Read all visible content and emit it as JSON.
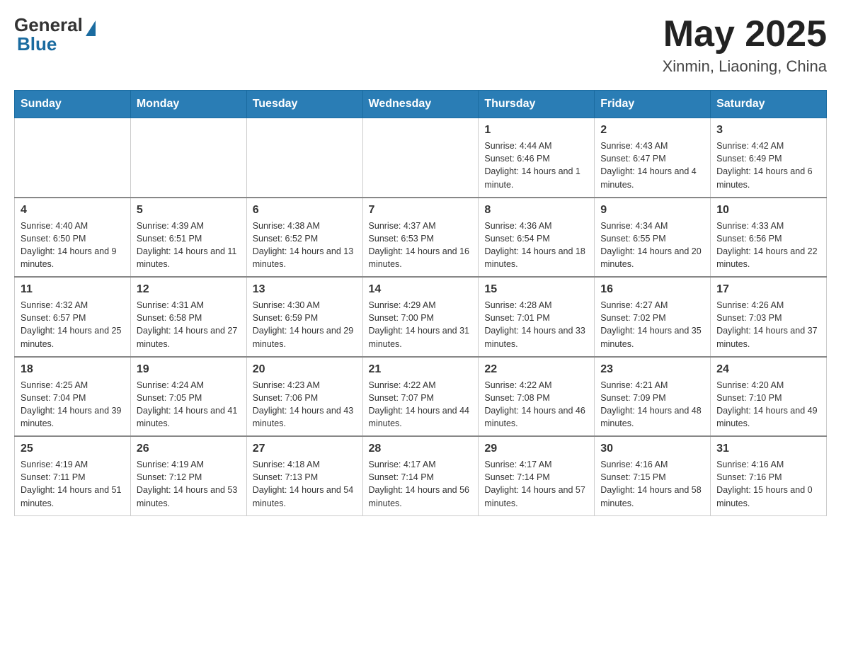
{
  "header": {
    "logo_general": "General",
    "logo_blue": "Blue",
    "month_title": "May 2025",
    "location": "Xinmin, Liaoning, China"
  },
  "days_of_week": [
    "Sunday",
    "Monday",
    "Tuesday",
    "Wednesday",
    "Thursday",
    "Friday",
    "Saturday"
  ],
  "weeks": [
    {
      "days": [
        {
          "num": "",
          "info": ""
        },
        {
          "num": "",
          "info": ""
        },
        {
          "num": "",
          "info": ""
        },
        {
          "num": "",
          "info": ""
        },
        {
          "num": "1",
          "info": "Sunrise: 4:44 AM\nSunset: 6:46 PM\nDaylight: 14 hours and 1 minute."
        },
        {
          "num": "2",
          "info": "Sunrise: 4:43 AM\nSunset: 6:47 PM\nDaylight: 14 hours and 4 minutes."
        },
        {
          "num": "3",
          "info": "Sunrise: 4:42 AM\nSunset: 6:49 PM\nDaylight: 14 hours and 6 minutes."
        }
      ]
    },
    {
      "days": [
        {
          "num": "4",
          "info": "Sunrise: 4:40 AM\nSunset: 6:50 PM\nDaylight: 14 hours and 9 minutes."
        },
        {
          "num": "5",
          "info": "Sunrise: 4:39 AM\nSunset: 6:51 PM\nDaylight: 14 hours and 11 minutes."
        },
        {
          "num": "6",
          "info": "Sunrise: 4:38 AM\nSunset: 6:52 PM\nDaylight: 14 hours and 13 minutes."
        },
        {
          "num": "7",
          "info": "Sunrise: 4:37 AM\nSunset: 6:53 PM\nDaylight: 14 hours and 16 minutes."
        },
        {
          "num": "8",
          "info": "Sunrise: 4:36 AM\nSunset: 6:54 PM\nDaylight: 14 hours and 18 minutes."
        },
        {
          "num": "9",
          "info": "Sunrise: 4:34 AM\nSunset: 6:55 PM\nDaylight: 14 hours and 20 minutes."
        },
        {
          "num": "10",
          "info": "Sunrise: 4:33 AM\nSunset: 6:56 PM\nDaylight: 14 hours and 22 minutes."
        }
      ]
    },
    {
      "days": [
        {
          "num": "11",
          "info": "Sunrise: 4:32 AM\nSunset: 6:57 PM\nDaylight: 14 hours and 25 minutes."
        },
        {
          "num": "12",
          "info": "Sunrise: 4:31 AM\nSunset: 6:58 PM\nDaylight: 14 hours and 27 minutes."
        },
        {
          "num": "13",
          "info": "Sunrise: 4:30 AM\nSunset: 6:59 PM\nDaylight: 14 hours and 29 minutes."
        },
        {
          "num": "14",
          "info": "Sunrise: 4:29 AM\nSunset: 7:00 PM\nDaylight: 14 hours and 31 minutes."
        },
        {
          "num": "15",
          "info": "Sunrise: 4:28 AM\nSunset: 7:01 PM\nDaylight: 14 hours and 33 minutes."
        },
        {
          "num": "16",
          "info": "Sunrise: 4:27 AM\nSunset: 7:02 PM\nDaylight: 14 hours and 35 minutes."
        },
        {
          "num": "17",
          "info": "Sunrise: 4:26 AM\nSunset: 7:03 PM\nDaylight: 14 hours and 37 minutes."
        }
      ]
    },
    {
      "days": [
        {
          "num": "18",
          "info": "Sunrise: 4:25 AM\nSunset: 7:04 PM\nDaylight: 14 hours and 39 minutes."
        },
        {
          "num": "19",
          "info": "Sunrise: 4:24 AM\nSunset: 7:05 PM\nDaylight: 14 hours and 41 minutes."
        },
        {
          "num": "20",
          "info": "Sunrise: 4:23 AM\nSunset: 7:06 PM\nDaylight: 14 hours and 43 minutes."
        },
        {
          "num": "21",
          "info": "Sunrise: 4:22 AM\nSunset: 7:07 PM\nDaylight: 14 hours and 44 minutes."
        },
        {
          "num": "22",
          "info": "Sunrise: 4:22 AM\nSunset: 7:08 PM\nDaylight: 14 hours and 46 minutes."
        },
        {
          "num": "23",
          "info": "Sunrise: 4:21 AM\nSunset: 7:09 PM\nDaylight: 14 hours and 48 minutes."
        },
        {
          "num": "24",
          "info": "Sunrise: 4:20 AM\nSunset: 7:10 PM\nDaylight: 14 hours and 49 minutes."
        }
      ]
    },
    {
      "days": [
        {
          "num": "25",
          "info": "Sunrise: 4:19 AM\nSunset: 7:11 PM\nDaylight: 14 hours and 51 minutes."
        },
        {
          "num": "26",
          "info": "Sunrise: 4:19 AM\nSunset: 7:12 PM\nDaylight: 14 hours and 53 minutes."
        },
        {
          "num": "27",
          "info": "Sunrise: 4:18 AM\nSunset: 7:13 PM\nDaylight: 14 hours and 54 minutes."
        },
        {
          "num": "28",
          "info": "Sunrise: 4:17 AM\nSunset: 7:14 PM\nDaylight: 14 hours and 56 minutes."
        },
        {
          "num": "29",
          "info": "Sunrise: 4:17 AM\nSunset: 7:14 PM\nDaylight: 14 hours and 57 minutes."
        },
        {
          "num": "30",
          "info": "Sunrise: 4:16 AM\nSunset: 7:15 PM\nDaylight: 14 hours and 58 minutes."
        },
        {
          "num": "31",
          "info": "Sunrise: 4:16 AM\nSunset: 7:16 PM\nDaylight: 15 hours and 0 minutes."
        }
      ]
    }
  ]
}
